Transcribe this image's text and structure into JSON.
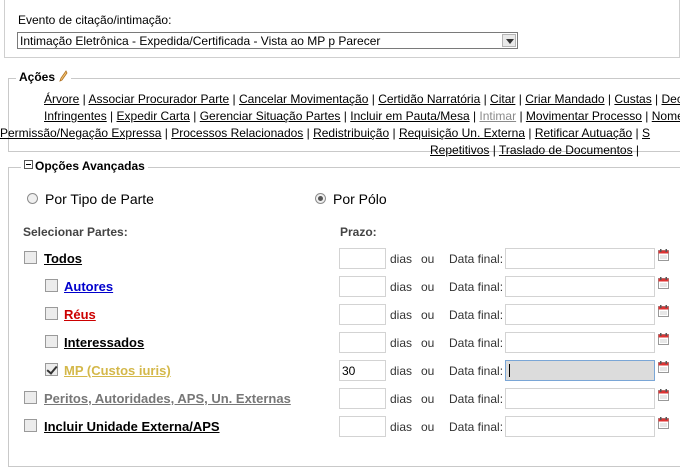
{
  "evento": {
    "label": "Evento de citação/intimação:",
    "selected": "Intimação Eletrônica - Expedida/Certificada - Vista ao MP p Parecer"
  },
  "acoes": {
    "legend": "Ações",
    "rows": [
      [
        {
          "t": "Árvore"
        },
        {
          "t": "Associar Procurador Parte"
        },
        {
          "t": "Cancelar Movimentação"
        },
        {
          "t": "Certidão Narratória"
        },
        {
          "t": "Citar"
        },
        {
          "t": "Criar Mandado"
        },
        {
          "t": "Custas"
        },
        {
          "t": "Decli"
        }
      ],
      [
        {
          "t": "Infringentes"
        },
        {
          "t": "Expedir Carta"
        },
        {
          "t": "Gerenciar Situação Partes"
        },
        {
          "t": "Incluir em Pauta/Mesa"
        },
        {
          "t": "Intimar",
          "disabled": true
        },
        {
          "t": "Movimentar Processo"
        },
        {
          "t": "Nomea"
        }
      ],
      [
        {
          "t": "Permissão/Negação Expressa"
        },
        {
          "t": "Processos Relacionados"
        },
        {
          "t": "Redistribuição"
        },
        {
          "t": "Requisição Un. Externa"
        },
        {
          "t": "Retificar Autuação"
        },
        {
          "t": "S"
        }
      ],
      [
        {
          "t": "Repetitivos"
        },
        {
          "t": "Traslado de Documentos"
        }
      ]
    ]
  },
  "opcoes": {
    "legend": "Opções Avançadas",
    "radio_tipo": "Por Tipo de Parte",
    "radio_polo": "Por Pólo",
    "selecionar_partes": "Selecionar Partes:",
    "prazo": "Prazo:",
    "dias": "dias",
    "ou": "ou",
    "data_final": "Data final:",
    "parties": [
      {
        "label": "Todos",
        "color": "#000000",
        "checked": false,
        "prazo": ""
      },
      {
        "label": "Autores",
        "color": "#0000cc",
        "checked": false,
        "prazo": ""
      },
      {
        "label": "Réus",
        "color": "#cc0000",
        "checked": false,
        "prazo": ""
      },
      {
        "label": "Interessados",
        "color": "#000000",
        "checked": false,
        "prazo": ""
      },
      {
        "label": "MP (Custos iuris)",
        "color": "#d4b84a",
        "checked": true,
        "prazo": "30"
      },
      {
        "label": "Peritos, Autoridades, APS, Un. Externas",
        "color": "#777777",
        "checked": false,
        "prazo": ""
      },
      {
        "label": "Incluir Unidade Externa/APS",
        "color": "#000000",
        "checked": false,
        "prazo": ""
      }
    ]
  }
}
